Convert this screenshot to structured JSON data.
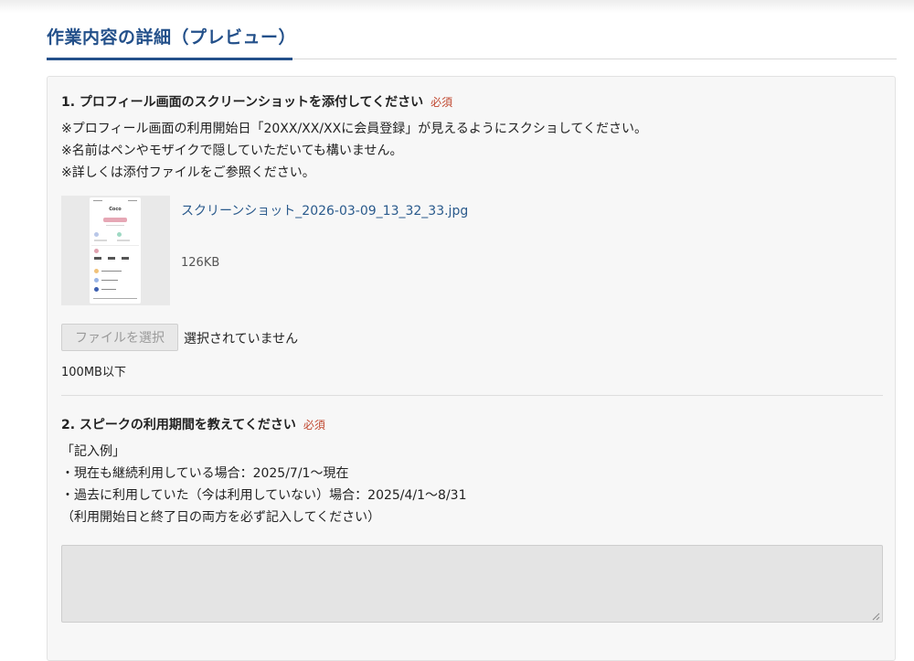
{
  "section": {
    "title": "作業内容の詳細（プレビュー）"
  },
  "question1": {
    "title": "1. プロフィール画面のスクリーンショットを添付してください",
    "required_label": "必須",
    "notes": [
      "※プロフィール画面の利用開始日「20XX/XX/XXに会員登録」が見えるようにスクショしてください。",
      "※名前はペンやモザイクで隠していただいても構いません。",
      "※詳しくは添付ファイルをご参照ください。"
    ],
    "attachment": {
      "file_name": "スクリーンショット_2026-03-09_13_32_33.jpg",
      "file_size": "126KB",
      "thumbnail_text": "Coco"
    },
    "file_button_label": "ファイルを選択",
    "file_status": "選択されていません",
    "size_limit": "100MB以下"
  },
  "question2": {
    "title": "2. スピークの利用期間を教えてください",
    "required_label": "必須",
    "notes": [
      "「記入例」",
      "・現在も継続利用している場合：2025/7/1〜現在",
      "・過去に利用していた（今は利用していない）場合：2025/4/1〜8/31",
      "（利用開始日と終了日の両方を必ず記入してください）"
    ],
    "answer_value": ""
  }
}
